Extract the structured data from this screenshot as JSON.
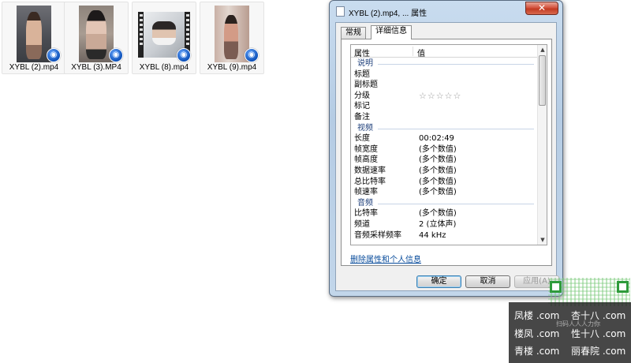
{
  "files": [
    {
      "name": "XYBL (2).mp4"
    },
    {
      "name": "XYBL (3).MP4"
    },
    {
      "name": "XYBL (8).mp4"
    },
    {
      "name": "XYBL (9).mp4"
    }
  ],
  "dialog": {
    "title": "XYBL (2).mp4, ... 属性",
    "close_symbol": "✕",
    "tabs": [
      "常规",
      "详细信息"
    ],
    "active_tab": "详细信息",
    "columns": {
      "property": "属性",
      "value": "值"
    },
    "sections": {
      "description": {
        "label": "说明",
        "rows": [
          {
            "k": "标题",
            "v": ""
          },
          {
            "k": "副标题",
            "v": ""
          },
          {
            "k": "分级",
            "v": ""
          },
          {
            "k": "标记",
            "v": ""
          },
          {
            "k": "备注",
            "v": ""
          }
        ],
        "rating_stars": "☆☆☆☆☆",
        "rating_value": 0
      },
      "video": {
        "label": "视频",
        "rows": [
          {
            "k": "长度",
            "v": "00:02:49"
          },
          {
            "k": "帧宽度",
            "v": "(多个数值)"
          },
          {
            "k": "帧高度",
            "v": "(多个数值)"
          },
          {
            "k": "数据速率",
            "v": "(多个数值)"
          },
          {
            "k": "总比特率",
            "v": "(多个数值)"
          },
          {
            "k": "帧速率",
            "v": "(多个数值)"
          }
        ]
      },
      "audio": {
        "label": "音频",
        "rows": [
          {
            "k": "比特率",
            "v": "(多个数值)"
          },
          {
            "k": "频道",
            "v": "2 (立体声)"
          },
          {
            "k": "音频采样频率",
            "v": "44 kHz"
          }
        ]
      }
    },
    "remove_link": "删除属性和个人信息",
    "buttons": {
      "ok": "确定",
      "cancel": "取消",
      "apply": "应用(A)"
    }
  },
  "watermark": {
    "lines": [
      [
        "凤楼 .com",
        "杏十八 .com"
      ],
      [
        "楼凤 .com",
        "性十八 .com"
      ],
      [
        "青楼 .com",
        "丽春院 .com"
      ]
    ],
    "sub": "扫码人人人力你"
  },
  "colors": {
    "accent_blue": "#0b4fb8",
    "link": "#0a4d9c",
    "close_red": "#c23a22",
    "qr_green": "#2e9b3b"
  }
}
